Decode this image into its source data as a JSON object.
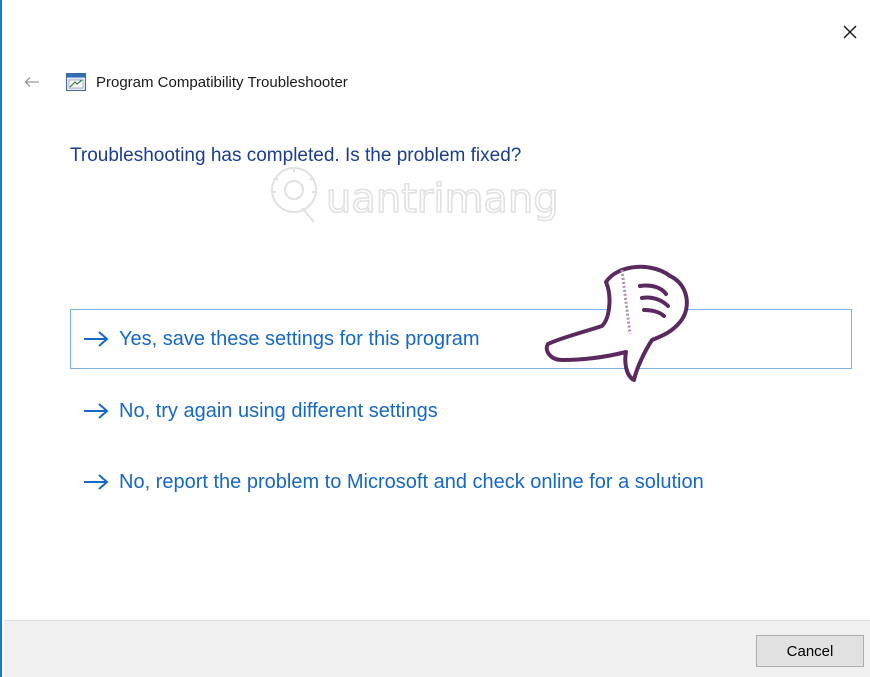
{
  "window": {
    "title": "Program Compatibility Troubleshooter",
    "accent_color": "#1979ca"
  },
  "header": {
    "back_icon": "back-arrow-icon",
    "app_icon": "troubleshooter-icon",
    "close_icon": "close-icon"
  },
  "main": {
    "question": "Troubleshooting has completed.  Is the problem fixed?",
    "question_color": "#1b3c8f",
    "options": [
      {
        "label": "Yes, save these settings for this program",
        "icon": "arrow-right-icon",
        "selected": true
      },
      {
        "label": "No, try again using different settings",
        "icon": "arrow-right-icon",
        "selected": false
      },
      {
        "label": "No, report the problem to Microsoft and check online for a solution",
        "icon": "arrow-right-icon",
        "selected": false
      }
    ],
    "option_color": "#1668c4"
  },
  "watermark": {
    "text": "uantrimang",
    "icon": "lightbulb-icon"
  },
  "overlay": {
    "icon": "pointing-hand-icon"
  },
  "footer": {
    "cancel_label": "Cancel"
  }
}
